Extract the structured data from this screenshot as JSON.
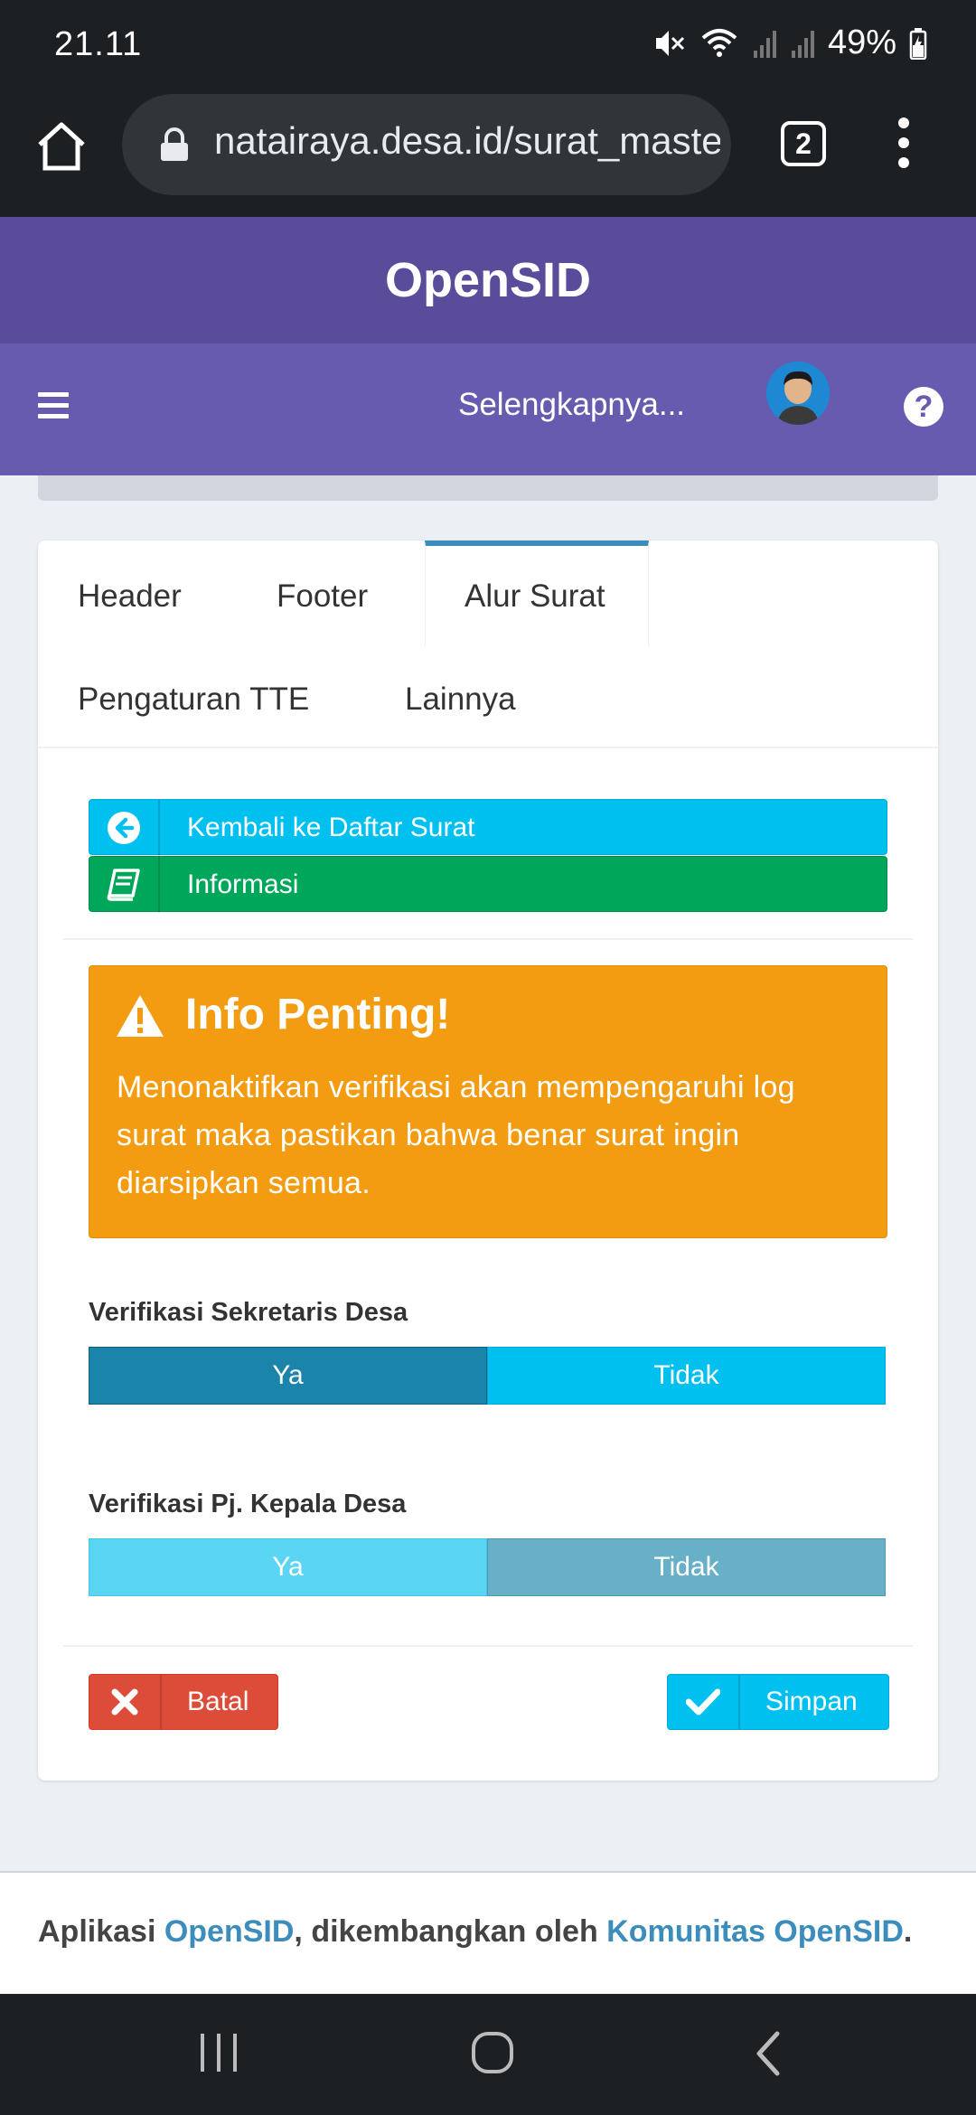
{
  "status_bar": {
    "time": "21.11",
    "battery": "49%"
  },
  "browser": {
    "url": "natairaya.desa.id/surat_master",
    "tab_count": "2"
  },
  "app": {
    "brand": "OpenSID",
    "nav_more": "Selengkapnya..."
  },
  "tabs": [
    {
      "label": "Header",
      "active": false
    },
    {
      "label": "Footer",
      "active": false
    },
    {
      "label": "Alur Surat",
      "active": true
    },
    {
      "label": "Pengaturan TTE",
      "active": false
    },
    {
      "label": "Lainnya",
      "active": false
    }
  ],
  "actions": {
    "back_label": "Kembali ke Daftar Surat",
    "info_label": "Informasi"
  },
  "alert": {
    "title": "Info Penting!",
    "message": "Menonaktifkan verifikasi akan mempengaruhi log surat maka pastikan bahwa benar surat ingin diarsipkan semua."
  },
  "fields": [
    {
      "label": "Verifikasi Sekretaris Desa",
      "yes": "Ya",
      "no": "Tidak",
      "selected": "Ya"
    },
    {
      "label": "Verifikasi Pj. Kepala Desa",
      "yes": "Ya",
      "no": "Tidak",
      "selected": "Tidak"
    }
  ],
  "form_buttons": {
    "cancel": "Batal",
    "save": "Simpan"
  },
  "footer": {
    "prefix": "Aplikasi ",
    "app_link": "OpenSID",
    "middle": ", dikembangkan oleh ",
    "community_link": "Komunitas OpenSID",
    "suffix": "."
  },
  "colors": {
    "brand_dark": "#5b4c9b",
    "brand_nav": "#675baf",
    "info": "#00c0ef",
    "success": "#00a65a",
    "warning": "#f39c12",
    "danger": "#dd4b39",
    "link": "#3c8dbc"
  },
  "icons": {
    "back": "circle-arrow-left-icon",
    "info": "book-icon",
    "alert": "warning-triangle-icon",
    "cancel": "close-icon",
    "save": "check-icon"
  }
}
